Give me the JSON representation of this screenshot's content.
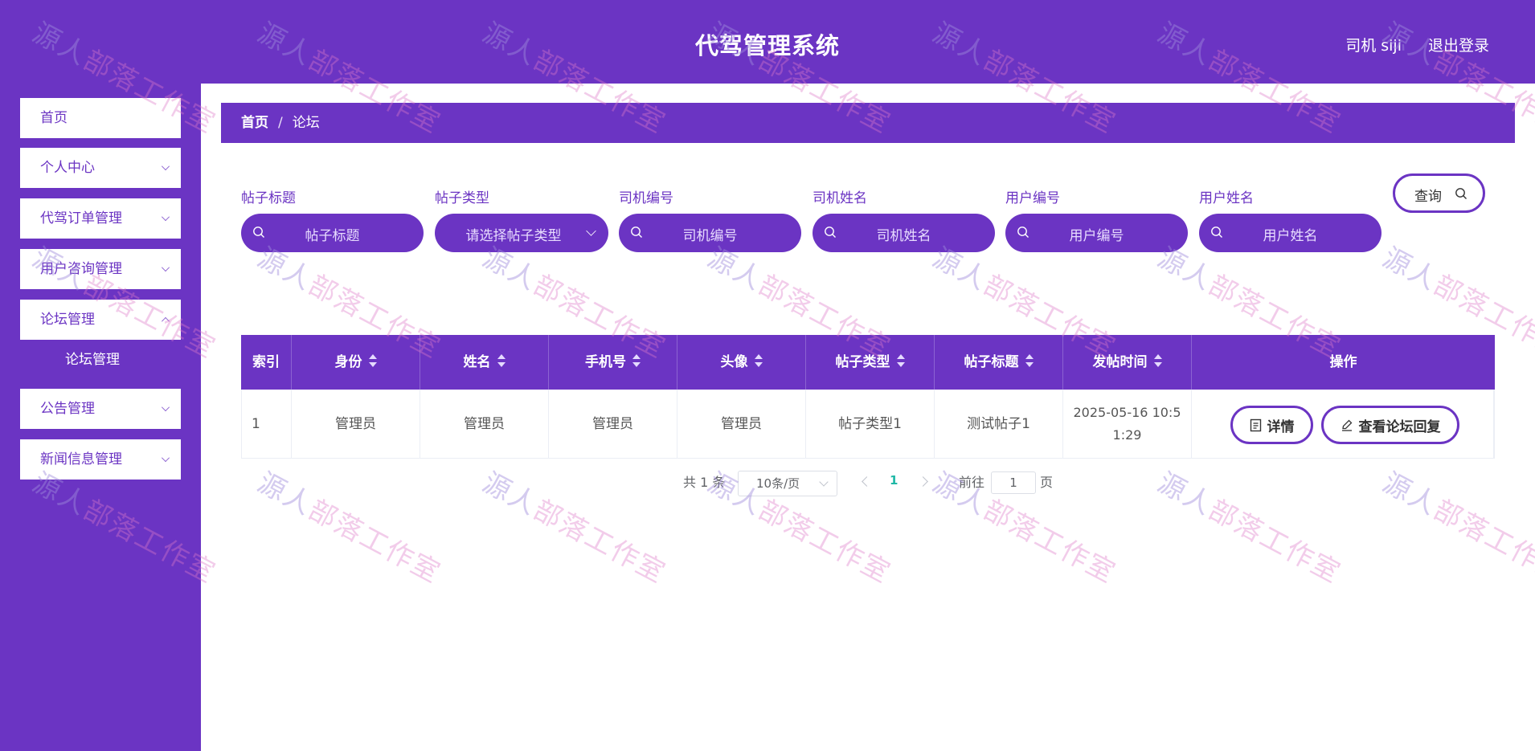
{
  "header": {
    "title": "代驾管理系统",
    "user": "司机 siji",
    "logout": "退出登录"
  },
  "sidebar": {
    "items": [
      {
        "label": "首页"
      },
      {
        "label": "个人中心"
      },
      {
        "label": "代驾订单管理"
      },
      {
        "label": "用户咨询管理"
      },
      {
        "label": "论坛管理"
      },
      {
        "label": "公告管理"
      },
      {
        "label": "新闻信息管理"
      }
    ],
    "submenu": {
      "label": "论坛管理"
    }
  },
  "breadcrumb": {
    "home": "首页",
    "separator": "/",
    "current": "论坛"
  },
  "filters": [
    {
      "label": "帖子标题",
      "placeholder": "帖子标题"
    },
    {
      "label": "帖子类型",
      "placeholder": "请选择帖子类型"
    },
    {
      "label": "司机编号",
      "placeholder": "司机编号"
    },
    {
      "label": "司机姓名",
      "placeholder": "司机姓名"
    },
    {
      "label": "用户编号",
      "placeholder": "用户编号"
    },
    {
      "label": "用户姓名",
      "placeholder": "用户姓名"
    }
  ],
  "query_button": "查询",
  "table": {
    "columns": [
      "索引",
      "身份",
      "姓名",
      "手机号",
      "头像",
      "帖子类型",
      "帖子标题",
      "发帖时间",
      "操作"
    ],
    "rows": [
      {
        "index": "1",
        "identity": "管理员",
        "name": "管理员",
        "phone": "管理员",
        "avatar": "管理员",
        "post_type": "帖子类型1",
        "post_title": "测试帖子1",
        "post_time_line1": "2025-05-16 10:5",
        "post_time_line2": "1:29",
        "actions": [
          "详情",
          "查看论坛回复"
        ]
      }
    ]
  },
  "pagination": {
    "total": "共 1 条",
    "page_size": "10条/页",
    "current_page": "1",
    "goto_label": "前往",
    "goto_value": "1",
    "page_suffix": "页"
  },
  "watermark": "源人部落工作室",
  "colors": {
    "primary": "#6b34c3",
    "active_page": "#1fb8a6"
  }
}
